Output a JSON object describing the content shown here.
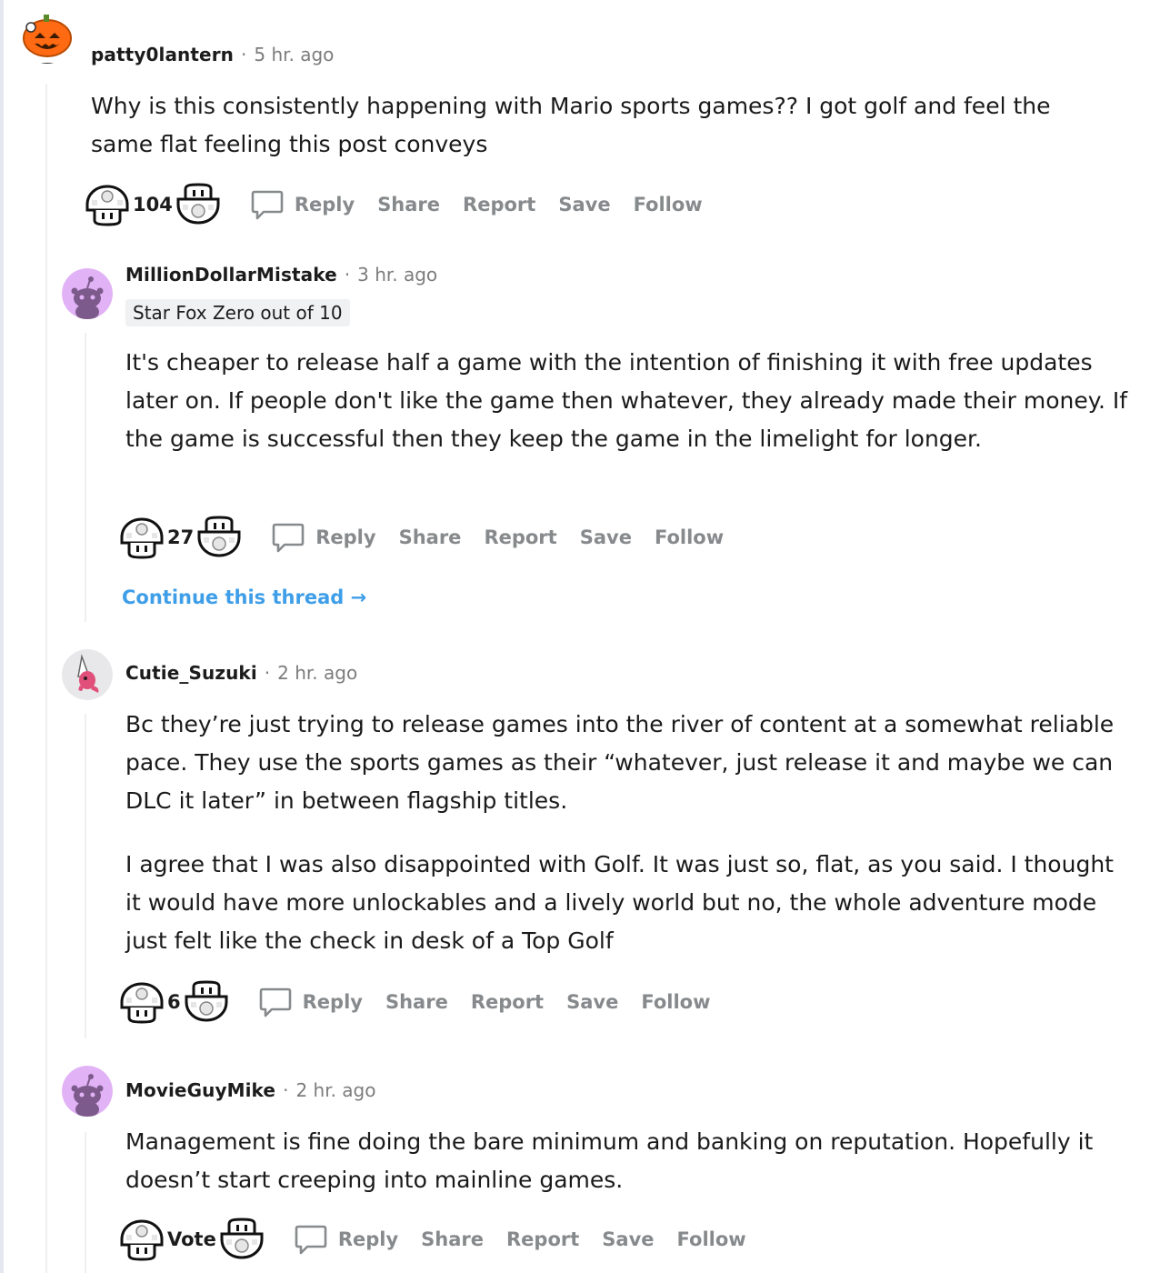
{
  "colors": {
    "accent_link": "#3e9ee8",
    "action_gray": "#878a8c",
    "meta_gray": "#7c7c7c",
    "flair_bg": "#f0f1f3",
    "avatar_purple": "#e1b2f5",
    "avatar_orange": "#ff6a13"
  },
  "actions": {
    "reply": "Reply",
    "share": "Share",
    "report": "Report",
    "save": "Save",
    "follow": "Follow"
  },
  "comments": [
    {
      "username": "patty0lantern",
      "time": "5 hr. ago",
      "flair": "",
      "paragraphs": [
        "Why is this consistently happening with Mario sports games?? I got golf and feel the same flat feeling this post conveys"
      ],
      "votes": "104",
      "avatar_icon": "jack-o-lantern-snoo-avatar-icon"
    },
    {
      "username": "MillionDollarMistake",
      "time": "3 hr. ago",
      "flair": "Star Fox Zero out of 10",
      "paragraphs": [
        "It's cheaper to release half a game with the intention of finishing it with free updates later on. If people don't like the game then whatever, they already made their money. If the game is successful then they keep the game in the limelight for longer."
      ],
      "votes": "27",
      "continue_thread": "Continue this thread",
      "avatar_icon": "default-snoo-avatar-icon"
    },
    {
      "username": "Cutie_Suzuki",
      "time": "2 hr. ago",
      "flair": "",
      "paragraphs": [
        "Bc they’re just trying to release games into the river of content at a somewhat reliable pace. They use the sports games as their “whatever, just release it and maybe we can DLC it later” in between flagship titles.",
        "I agree that I was also disappointed with Golf. It was just so, flat, as you said. I thought it would have more unlockables and a lively world but no, the whole adventure mode just felt like the check in desk of a Top Golf"
      ],
      "votes": "6",
      "avatar_icon": "pink-creature-avatar-icon"
    },
    {
      "username": "MovieGuyMike",
      "time": "2 hr. ago",
      "flair": "",
      "paragraphs": [
        "Management is fine doing the bare minimum and banking on reputation. Hopefully it doesn’t start creeping into mainline games."
      ],
      "votes": "Vote",
      "avatar_icon": "default-snoo-avatar-icon"
    }
  ]
}
